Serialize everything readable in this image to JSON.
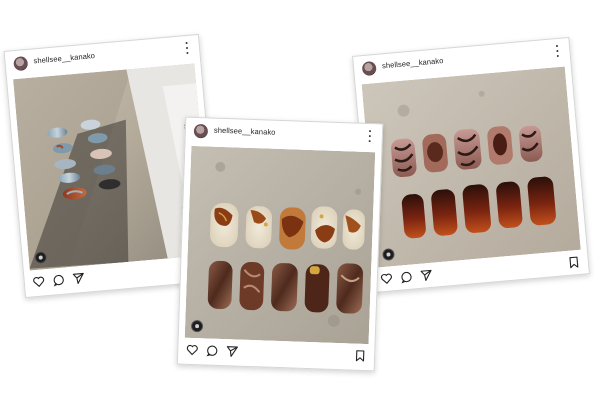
{
  "posts": [
    {
      "username": "shellsee__kanako",
      "icons": {
        "avatar": "avatar",
        "more": "more-vertical-icon",
        "like": "heart-icon",
        "comment": "comment-icon",
        "share": "send-icon",
        "carousel": "carousel-icon"
      }
    },
    {
      "username": "shellsee__kanako",
      "icons": {
        "avatar": "avatar",
        "more": "more-vertical-icon",
        "like": "heart-icon",
        "comment": "comment-icon",
        "share": "send-icon",
        "save": "bookmark-icon",
        "carousel": "carousel-icon"
      }
    },
    {
      "username": "shellsee__kanako",
      "icons": {
        "avatar": "avatar",
        "more": "more-vertical-icon",
        "like": "heart-icon",
        "comment": "comment-icon",
        "share": "send-icon",
        "save": "bookmark-icon",
        "carousel": "carousel-icon"
      }
    }
  ],
  "colors": {
    "card_border": "#d6d6d6",
    "icon": "#222222",
    "stone_background": "#b9b4ab",
    "nail_brown": "#6b3a22",
    "nail_cream": "#e9e0cf",
    "nail_blue": "#7e98aa"
  }
}
